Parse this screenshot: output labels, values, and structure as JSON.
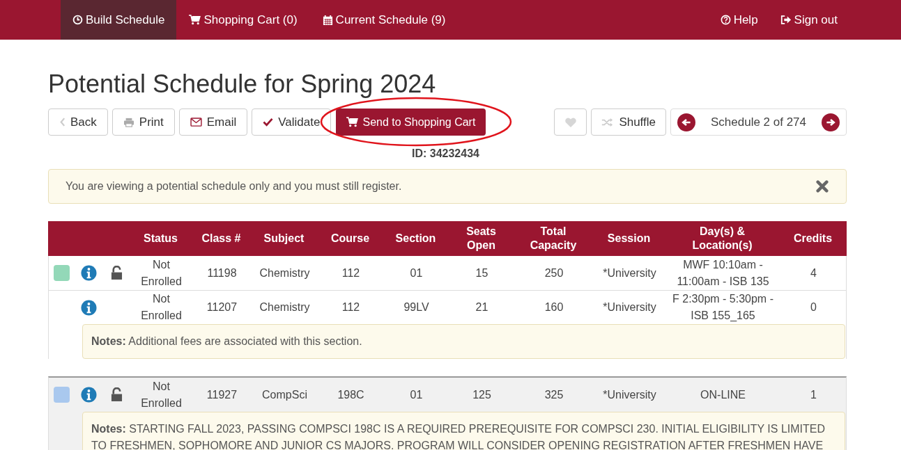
{
  "nav": {
    "tabs": [
      {
        "label": "Build Schedule",
        "selected": true
      },
      {
        "label": "Shopping Cart (0)",
        "selected": false
      },
      {
        "label": "Current Schedule (9)",
        "selected": false
      }
    ],
    "right": [
      {
        "label": "Help"
      },
      {
        "label": "Sign out"
      }
    ]
  },
  "title": "Potential Schedule for Spring 2024",
  "toolbar": {
    "buttons": [
      {
        "label": "Back",
        "kind": "default"
      },
      {
        "label": "Print",
        "kind": "default"
      },
      {
        "label": "Email",
        "kind": "default"
      },
      {
        "label": "Validate",
        "kind": "default"
      },
      {
        "label": "Send to Shopping Cart",
        "kind": "primary",
        "circled": true
      }
    ],
    "favorite": {
      "on": false
    },
    "shuffle": {
      "label": "Shuffle"
    },
    "pager": {
      "label": "Schedule 2 of 274"
    },
    "id_label": "ID: 34232434"
  },
  "alert": {
    "text": "You are viewing a potential schedule only and you must still register."
  },
  "table": {
    "columns": [
      "Status",
      "Class #",
      "Subject",
      "Course",
      "Section",
      "Seats Open",
      "Total Capacity",
      "Session",
      "Day(s) & Location(s)",
      "Credits"
    ],
    "groups": [
      {
        "color": "#93d8b8",
        "shaded": false,
        "rows": [
          {
            "kind": "primary",
            "locked": false,
            "cells": [
              "Not Enrolled",
              "11198",
              "Chemistry",
              "112",
              "01",
              "15",
              "250",
              "*University",
              "MWF 10:10am - 11:00am - ISB 135",
              "4"
            ]
          },
          {
            "kind": "secondary",
            "cells": [
              "Not Enrolled",
              "11207",
              "Chemistry",
              "112",
              "99LV",
              "21",
              "160",
              "*University",
              "F 2:30pm - 5:30pm - ISB 155_165",
              "0"
            ]
          }
        ],
        "notes": "**Notes:** Additional fees are associated with this section."
      },
      {
        "color": "#a9c8ee",
        "shaded": true,
        "rows": [
          {
            "kind": "primary",
            "locked": false,
            "cells": [
              "Not Enrolled",
              "11927",
              "CompSci",
              "198C",
              "01",
              "125",
              "325",
              "*University",
              "ON-LINE",
              "1"
            ]
          }
        ],
        "notes": "**Notes:** STARTING FALL 2023, PASSING COMPSCI 198C IS A REQUIRED PREREQUISITE FOR COMPSCI 230. INITIAL ELIGIBILITY IS LIMITED TO FRESHMEN, SOPHOMORE AND JUNIOR CS MAJORS. PROGRAM WILL CONSIDER OPENING REGISTRATION AFTER FRESHMEN HAVE"
      }
    ]
  }
}
